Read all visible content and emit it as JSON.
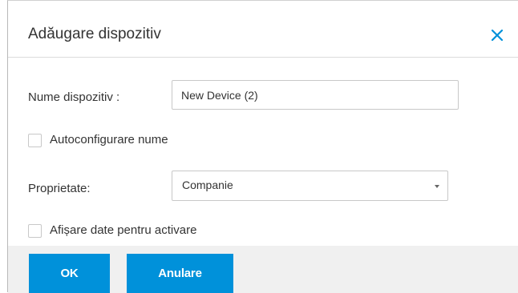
{
  "dialog": {
    "title": "Adăugare dispozitiv",
    "close_icon": "close-icon",
    "accent_color": "#0091da"
  },
  "form": {
    "device_name_label": "Nume dispozitiv :",
    "device_name_value": "New Device (2)",
    "auto_config_label": "Autoconfigurare nume",
    "auto_config_checked": false,
    "property_label": "Proprietate:",
    "property_selected": "Companie",
    "show_activation_label": "Afișare date pentru activare",
    "show_activation_checked": false
  },
  "footer": {
    "ok_label": "OK",
    "cancel_label": "Anulare"
  }
}
